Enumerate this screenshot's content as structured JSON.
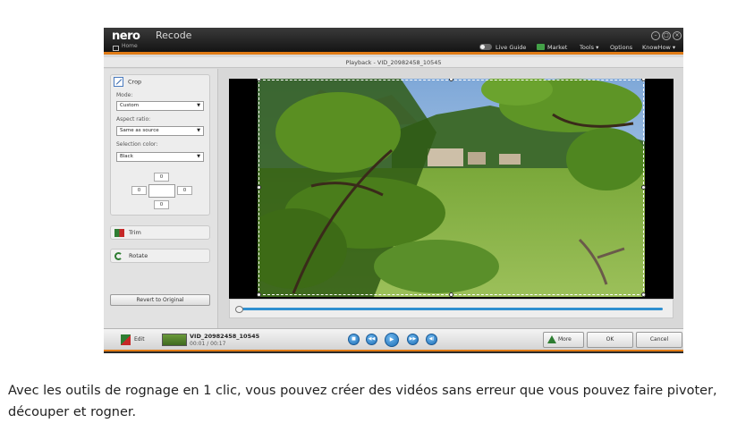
{
  "titlebar": {
    "brand": "nero",
    "product": "Recode",
    "home_label": "Home",
    "live_guide": "Live Guide",
    "market": "Market",
    "tools": "Tools ▾",
    "options": "Options",
    "knowhow": "KnowHow ▾"
  },
  "playback_title": "Playback - VID_20982458_10545",
  "crop": {
    "title": "Crop",
    "mode_label": "Mode:",
    "mode_value": "Custom",
    "aspect_label": "Aspect ratio:",
    "aspect_value": "Same as source",
    "color_label": "Selection color:",
    "color_value": "Black",
    "top": "0",
    "left": "0",
    "right": "0",
    "bottom": "0"
  },
  "trim_label": "Trim",
  "rotate_label": "Rotate",
  "revert_label": "Revert to Original",
  "bottom": {
    "edit_label": "Edit",
    "clip_name": "VID_20982458_10545",
    "clip_time": "00:01 / 00:17",
    "more_label": "More",
    "ok_label": "OK",
    "cancel_label": "Cancel"
  },
  "caption": "Avec les outils de rognage en 1 clic, vous pouvez créer des vidéos sans erreur que vous pouvez faire pivoter, découper et rogner.",
  "colors": {
    "accent": "#e07b16",
    "progress": "#2f8fd0",
    "control": "#1d6db3"
  }
}
